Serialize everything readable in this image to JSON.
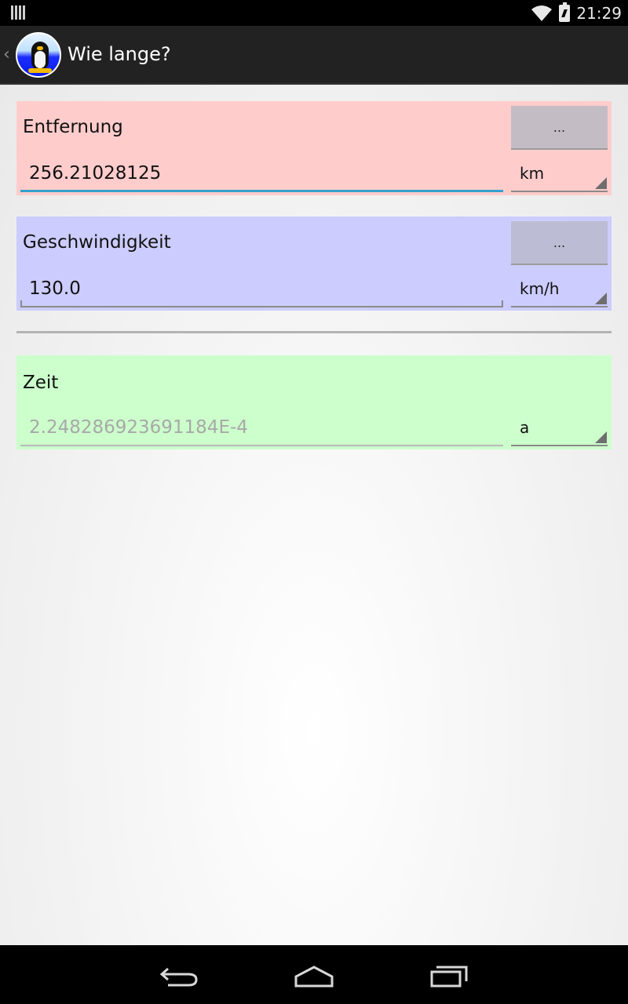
{
  "status_bar": {
    "time": "21:29",
    "icons": [
      "notification-bars-icon",
      "wifi-icon",
      "battery-charging-icon"
    ]
  },
  "action_bar": {
    "title": "Wie lange?",
    "up_icon": "chevron-left-icon",
    "app_icon": "penguin-app-icon"
  },
  "colors": {
    "distance_panel": "#ffcccc",
    "speed_panel": "#ccccff",
    "time_panel": "#ccffcc",
    "focus_underline": "#33a0cc"
  },
  "distance": {
    "label": "Entfernung",
    "value": "256.21028125",
    "button_label": "...",
    "unit": "km"
  },
  "speed": {
    "label": "Geschwindigkeit",
    "value": "130.0",
    "button_label": "...",
    "unit": "km/h"
  },
  "time": {
    "label": "Zeit",
    "value": "2.248286923691184E-4",
    "unit": "a"
  },
  "nav_bar": {
    "buttons": [
      "back-icon",
      "home-icon",
      "recent-apps-icon"
    ]
  }
}
